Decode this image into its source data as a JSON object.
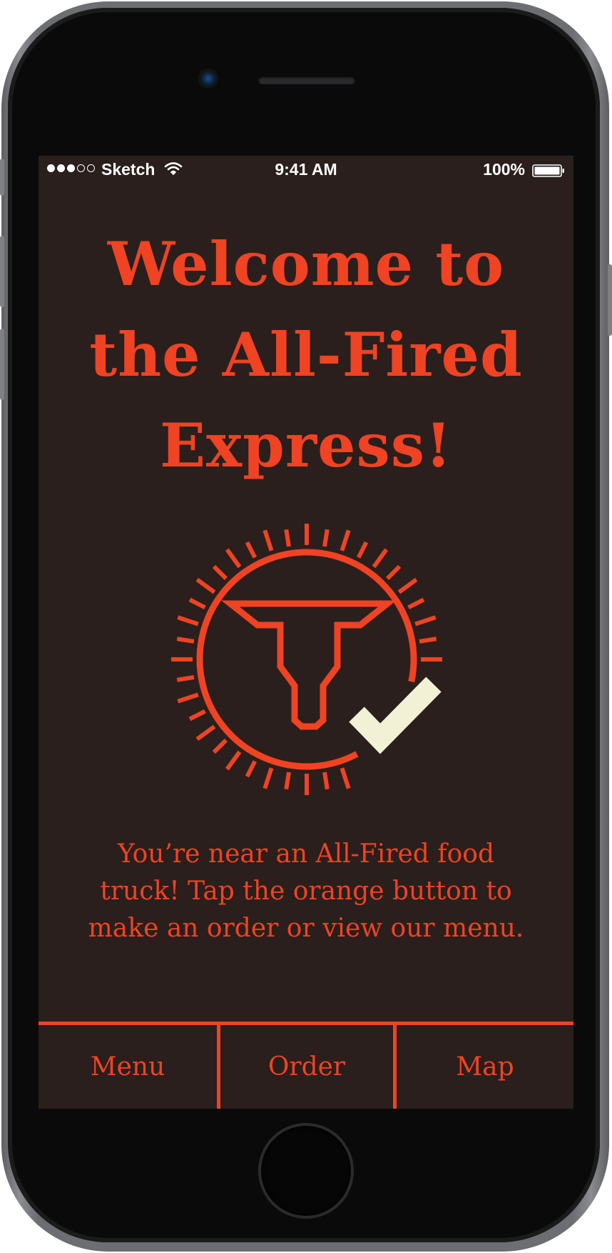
{
  "status_bar": {
    "carrier": "Sketch",
    "time": "9:41 AM",
    "battery": "100%",
    "signal_strength": 3,
    "signal_max": 5
  },
  "main": {
    "title_lines": [
      "Welcome to",
      "the All-Fired",
      "Express!"
    ],
    "message_lines": [
      "You’re near an All-Fired food",
      "truck! Tap the orange button to",
      "make an order or view our menu."
    ],
    "logo_icon": "longhorn-sun-icon",
    "check_icon": "checkmark-icon"
  },
  "tab_bar": {
    "tabs": [
      {
        "label": "Menu"
      },
      {
        "label": "Order"
      },
      {
        "label": "Map"
      }
    ]
  },
  "colors": {
    "accent": "#ef4323",
    "background": "#2a1f1c",
    "check": "#f2f1d5",
    "status_text": "#ffffff"
  }
}
